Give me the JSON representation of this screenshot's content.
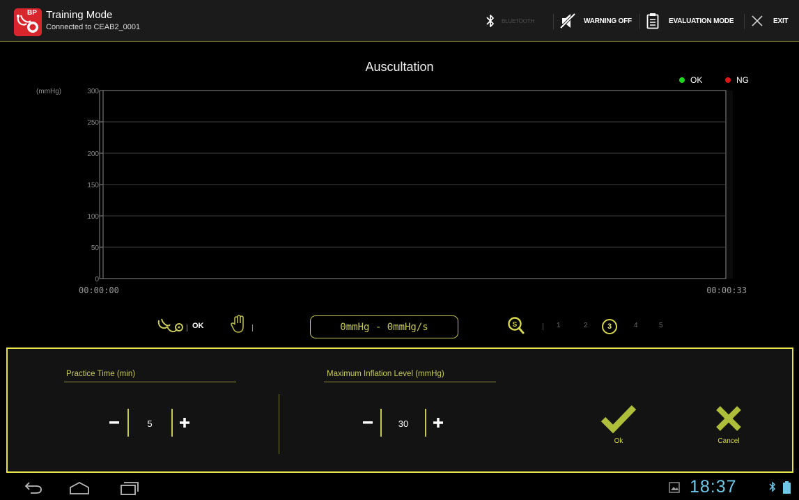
{
  "header": {
    "title": "Training Mode",
    "subtitle": "Connected to CEAB2_0001",
    "app_badge": "BP",
    "bluetooth_label": "BLUETOOTH",
    "warning_label": "WARNING OFF",
    "evaluation_label": "EVALUATION MODE",
    "exit_label": "EXIT"
  },
  "chart_data": {
    "type": "line",
    "title": "Auscultation",
    "ylabel": "(mmHg)",
    "ylim": [
      0,
      300
    ],
    "yticks": [
      "300",
      "250",
      "200",
      "150",
      "100",
      "50",
      "0"
    ],
    "x_start": "00:00:00",
    "x_end": "00:00:33",
    "legend": [
      {
        "name": "OK",
        "color": "#1fd61f"
      },
      {
        "name": "NG",
        "color": "#e01515"
      }
    ],
    "legend_placement": "top-right",
    "grid": true,
    "series": []
  },
  "status": {
    "stethoscope_status": "OK",
    "hand_status": "",
    "range_text": "0mmHg - 0mmHg/s",
    "levels": [
      "1",
      "2",
      "3",
      "4",
      "5"
    ],
    "selected_level": "3"
  },
  "settings": {
    "practice_time": {
      "label": "Practice Time  (min)",
      "value": "5"
    },
    "max_inflation": {
      "label": "Maximum Inflation Level  (mmHg)",
      "value": "30"
    },
    "ok_label": "Ok",
    "cancel_label": "Cancel"
  },
  "system": {
    "clock": "18:37"
  },
  "colors": {
    "accent": "#c7c95a",
    "panel_border": "#e7e44a",
    "clock": "#6fc7e8",
    "ok_dot": "#1fd61f",
    "ng_dot": "#e01515"
  }
}
